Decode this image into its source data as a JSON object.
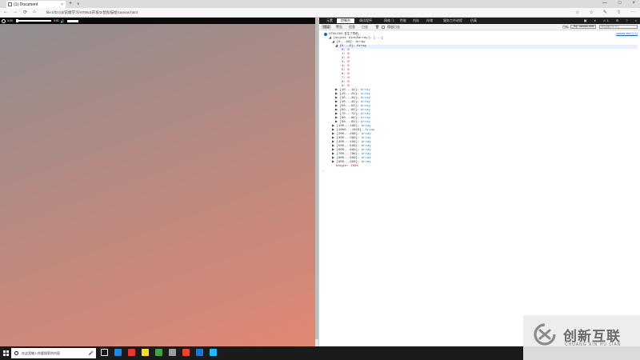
{
  "browser": {
    "tab_title": "(1) Document",
    "tab_close": "×",
    "new_tab": "+",
    "tab_menu": "∨",
    "url": "file:///D:/zd/前端学习/HTML5开发/2/鼠标描绘/canvas.html",
    "window_controls": [
      "—",
      "□",
      "×"
    ],
    "nav": {
      "back": "←",
      "forward": "→",
      "refresh": "⟳",
      "home": "⌂"
    },
    "addr_right": [
      "☆",
      "☆",
      "✎",
      "⇧",
      "···"
    ]
  },
  "media": {
    "current_time": "0:00",
    "total_time": "0:00",
    "volume_icon": "🔊",
    "progress": 0.0
  },
  "devtools": {
    "tabs": [
      "元素",
      "控制台",
      "调试程序",
      "网络 ①",
      "性能",
      "内存",
      "存储",
      "服务工作进程",
      "仿真"
    ],
    "active_tab": "控制台",
    "right_icons": [
      "▣",
      "●",
      "⚠ 1",
      "⚙",
      "?",
      "×"
    ],
    "toolbar": {
      "btn_error": "错误",
      "btn_warning": "警告",
      "btn_info": "信息",
      "btn_log": "日志",
      "btn_clear": "🗑",
      "preserve_log": "保留日志",
      "target_label": "目标",
      "target_value": "_top: canvas.html",
      "filter_placeholder": "筛选器(Ctrl+F)"
    },
    "source_link": "canvas.html (1,1)",
    "info_text": "HTML1300: 发生了导航。",
    "console": {
      "root": "[object Uint8Array]: [...]",
      "expanded_group": "[0...99]: Array",
      "expanded_subgroup": "[0...9]: Array",
      "items": [
        {
          "index": "0",
          "value": "0"
        },
        {
          "index": "1",
          "value": "0"
        },
        {
          "index": "2",
          "value": "0"
        },
        {
          "index": "3",
          "value": "0"
        },
        {
          "index": "4",
          "value": "0"
        },
        {
          "index": "5",
          "value": "0"
        },
        {
          "index": "6",
          "value": "0"
        },
        {
          "index": "7",
          "value": "0"
        },
        {
          "index": "8",
          "value": "0"
        },
        {
          "index": "9",
          "value": "0"
        }
      ],
      "subgroups": [
        "[10...19]",
        "[20...29]",
        "[30...39]",
        "[40...49]",
        "[50...59]",
        "[60...69]",
        "[70...79]",
        "[80...89]",
        "[90...99]"
      ],
      "groups": [
        "[100...199]",
        "[1000...1023]",
        "[200...299]",
        "[300...399]",
        "[400...499]",
        "[500...599]",
        "[600...699]",
        "[700...799]",
        "[800...899]",
        "[900...999]"
      ],
      "array_label": "Array",
      "length_key": "length",
      "length_value": "1024",
      "prompt": "›"
    }
  },
  "taskbar": {
    "search_text": "在这里输入你要搜索的内容",
    "mic": "🎤",
    "icon_colors": [
      "#ffffff",
      "#1e88e5",
      "#e53935",
      "#fdd835",
      "#43a047",
      "#9e9e9e",
      "#ea4335",
      "#1976d2",
      "#29b6f6"
    ]
  },
  "watermark": {
    "brand_cn": "创新互联",
    "brand_en": "CHUANG XIN HU LIAN"
  }
}
